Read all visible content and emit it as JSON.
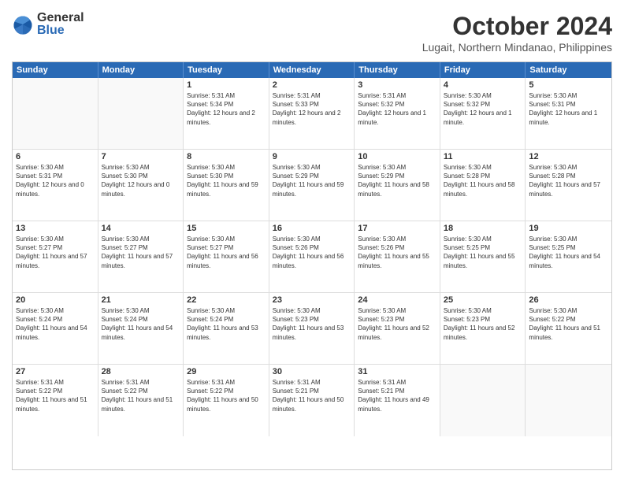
{
  "logo": {
    "general": "General",
    "blue": "Blue"
  },
  "title": "October 2024",
  "location": "Lugait, Northern Mindanao, Philippines",
  "header_days": [
    "Sunday",
    "Monday",
    "Tuesday",
    "Wednesday",
    "Thursday",
    "Friday",
    "Saturday"
  ],
  "weeks": [
    [
      {
        "day": "",
        "sunrise": "",
        "sunset": "",
        "daylight": ""
      },
      {
        "day": "",
        "sunrise": "",
        "sunset": "",
        "daylight": ""
      },
      {
        "day": "1",
        "sunrise": "Sunrise: 5:31 AM",
        "sunset": "Sunset: 5:34 PM",
        "daylight": "Daylight: 12 hours and 2 minutes."
      },
      {
        "day": "2",
        "sunrise": "Sunrise: 5:31 AM",
        "sunset": "Sunset: 5:33 PM",
        "daylight": "Daylight: 12 hours and 2 minutes."
      },
      {
        "day": "3",
        "sunrise": "Sunrise: 5:31 AM",
        "sunset": "Sunset: 5:32 PM",
        "daylight": "Daylight: 12 hours and 1 minute."
      },
      {
        "day": "4",
        "sunrise": "Sunrise: 5:30 AM",
        "sunset": "Sunset: 5:32 PM",
        "daylight": "Daylight: 12 hours and 1 minute."
      },
      {
        "day": "5",
        "sunrise": "Sunrise: 5:30 AM",
        "sunset": "Sunset: 5:31 PM",
        "daylight": "Daylight: 12 hours and 1 minute."
      }
    ],
    [
      {
        "day": "6",
        "sunrise": "Sunrise: 5:30 AM",
        "sunset": "Sunset: 5:31 PM",
        "daylight": "Daylight: 12 hours and 0 minutes."
      },
      {
        "day": "7",
        "sunrise": "Sunrise: 5:30 AM",
        "sunset": "Sunset: 5:30 PM",
        "daylight": "Daylight: 12 hours and 0 minutes."
      },
      {
        "day": "8",
        "sunrise": "Sunrise: 5:30 AM",
        "sunset": "Sunset: 5:30 PM",
        "daylight": "Daylight: 11 hours and 59 minutes."
      },
      {
        "day": "9",
        "sunrise": "Sunrise: 5:30 AM",
        "sunset": "Sunset: 5:29 PM",
        "daylight": "Daylight: 11 hours and 59 minutes."
      },
      {
        "day": "10",
        "sunrise": "Sunrise: 5:30 AM",
        "sunset": "Sunset: 5:29 PM",
        "daylight": "Daylight: 11 hours and 58 minutes."
      },
      {
        "day": "11",
        "sunrise": "Sunrise: 5:30 AM",
        "sunset": "Sunset: 5:28 PM",
        "daylight": "Daylight: 11 hours and 58 minutes."
      },
      {
        "day": "12",
        "sunrise": "Sunrise: 5:30 AM",
        "sunset": "Sunset: 5:28 PM",
        "daylight": "Daylight: 11 hours and 57 minutes."
      }
    ],
    [
      {
        "day": "13",
        "sunrise": "Sunrise: 5:30 AM",
        "sunset": "Sunset: 5:27 PM",
        "daylight": "Daylight: 11 hours and 57 minutes."
      },
      {
        "day": "14",
        "sunrise": "Sunrise: 5:30 AM",
        "sunset": "Sunset: 5:27 PM",
        "daylight": "Daylight: 11 hours and 57 minutes."
      },
      {
        "day": "15",
        "sunrise": "Sunrise: 5:30 AM",
        "sunset": "Sunset: 5:27 PM",
        "daylight": "Daylight: 11 hours and 56 minutes."
      },
      {
        "day": "16",
        "sunrise": "Sunrise: 5:30 AM",
        "sunset": "Sunset: 5:26 PM",
        "daylight": "Daylight: 11 hours and 56 minutes."
      },
      {
        "day": "17",
        "sunrise": "Sunrise: 5:30 AM",
        "sunset": "Sunset: 5:26 PM",
        "daylight": "Daylight: 11 hours and 55 minutes."
      },
      {
        "day": "18",
        "sunrise": "Sunrise: 5:30 AM",
        "sunset": "Sunset: 5:25 PM",
        "daylight": "Daylight: 11 hours and 55 minutes."
      },
      {
        "day": "19",
        "sunrise": "Sunrise: 5:30 AM",
        "sunset": "Sunset: 5:25 PM",
        "daylight": "Daylight: 11 hours and 54 minutes."
      }
    ],
    [
      {
        "day": "20",
        "sunrise": "Sunrise: 5:30 AM",
        "sunset": "Sunset: 5:24 PM",
        "daylight": "Daylight: 11 hours and 54 minutes."
      },
      {
        "day": "21",
        "sunrise": "Sunrise: 5:30 AM",
        "sunset": "Sunset: 5:24 PM",
        "daylight": "Daylight: 11 hours and 54 minutes."
      },
      {
        "day": "22",
        "sunrise": "Sunrise: 5:30 AM",
        "sunset": "Sunset: 5:24 PM",
        "daylight": "Daylight: 11 hours and 53 minutes."
      },
      {
        "day": "23",
        "sunrise": "Sunrise: 5:30 AM",
        "sunset": "Sunset: 5:23 PM",
        "daylight": "Daylight: 11 hours and 53 minutes."
      },
      {
        "day": "24",
        "sunrise": "Sunrise: 5:30 AM",
        "sunset": "Sunset: 5:23 PM",
        "daylight": "Daylight: 11 hours and 52 minutes."
      },
      {
        "day": "25",
        "sunrise": "Sunrise: 5:30 AM",
        "sunset": "Sunset: 5:23 PM",
        "daylight": "Daylight: 11 hours and 52 minutes."
      },
      {
        "day": "26",
        "sunrise": "Sunrise: 5:30 AM",
        "sunset": "Sunset: 5:22 PM",
        "daylight": "Daylight: 11 hours and 51 minutes."
      }
    ],
    [
      {
        "day": "27",
        "sunrise": "Sunrise: 5:31 AM",
        "sunset": "Sunset: 5:22 PM",
        "daylight": "Daylight: 11 hours and 51 minutes."
      },
      {
        "day": "28",
        "sunrise": "Sunrise: 5:31 AM",
        "sunset": "Sunset: 5:22 PM",
        "daylight": "Daylight: 11 hours and 51 minutes."
      },
      {
        "day": "29",
        "sunrise": "Sunrise: 5:31 AM",
        "sunset": "Sunset: 5:22 PM",
        "daylight": "Daylight: 11 hours and 50 minutes."
      },
      {
        "day": "30",
        "sunrise": "Sunrise: 5:31 AM",
        "sunset": "Sunset: 5:21 PM",
        "daylight": "Daylight: 11 hours and 50 minutes."
      },
      {
        "day": "31",
        "sunrise": "Sunrise: 5:31 AM",
        "sunset": "Sunset: 5:21 PM",
        "daylight": "Daylight: 11 hours and 49 minutes."
      },
      {
        "day": "",
        "sunrise": "",
        "sunset": "",
        "daylight": ""
      },
      {
        "day": "",
        "sunrise": "",
        "sunset": "",
        "daylight": ""
      }
    ]
  ]
}
